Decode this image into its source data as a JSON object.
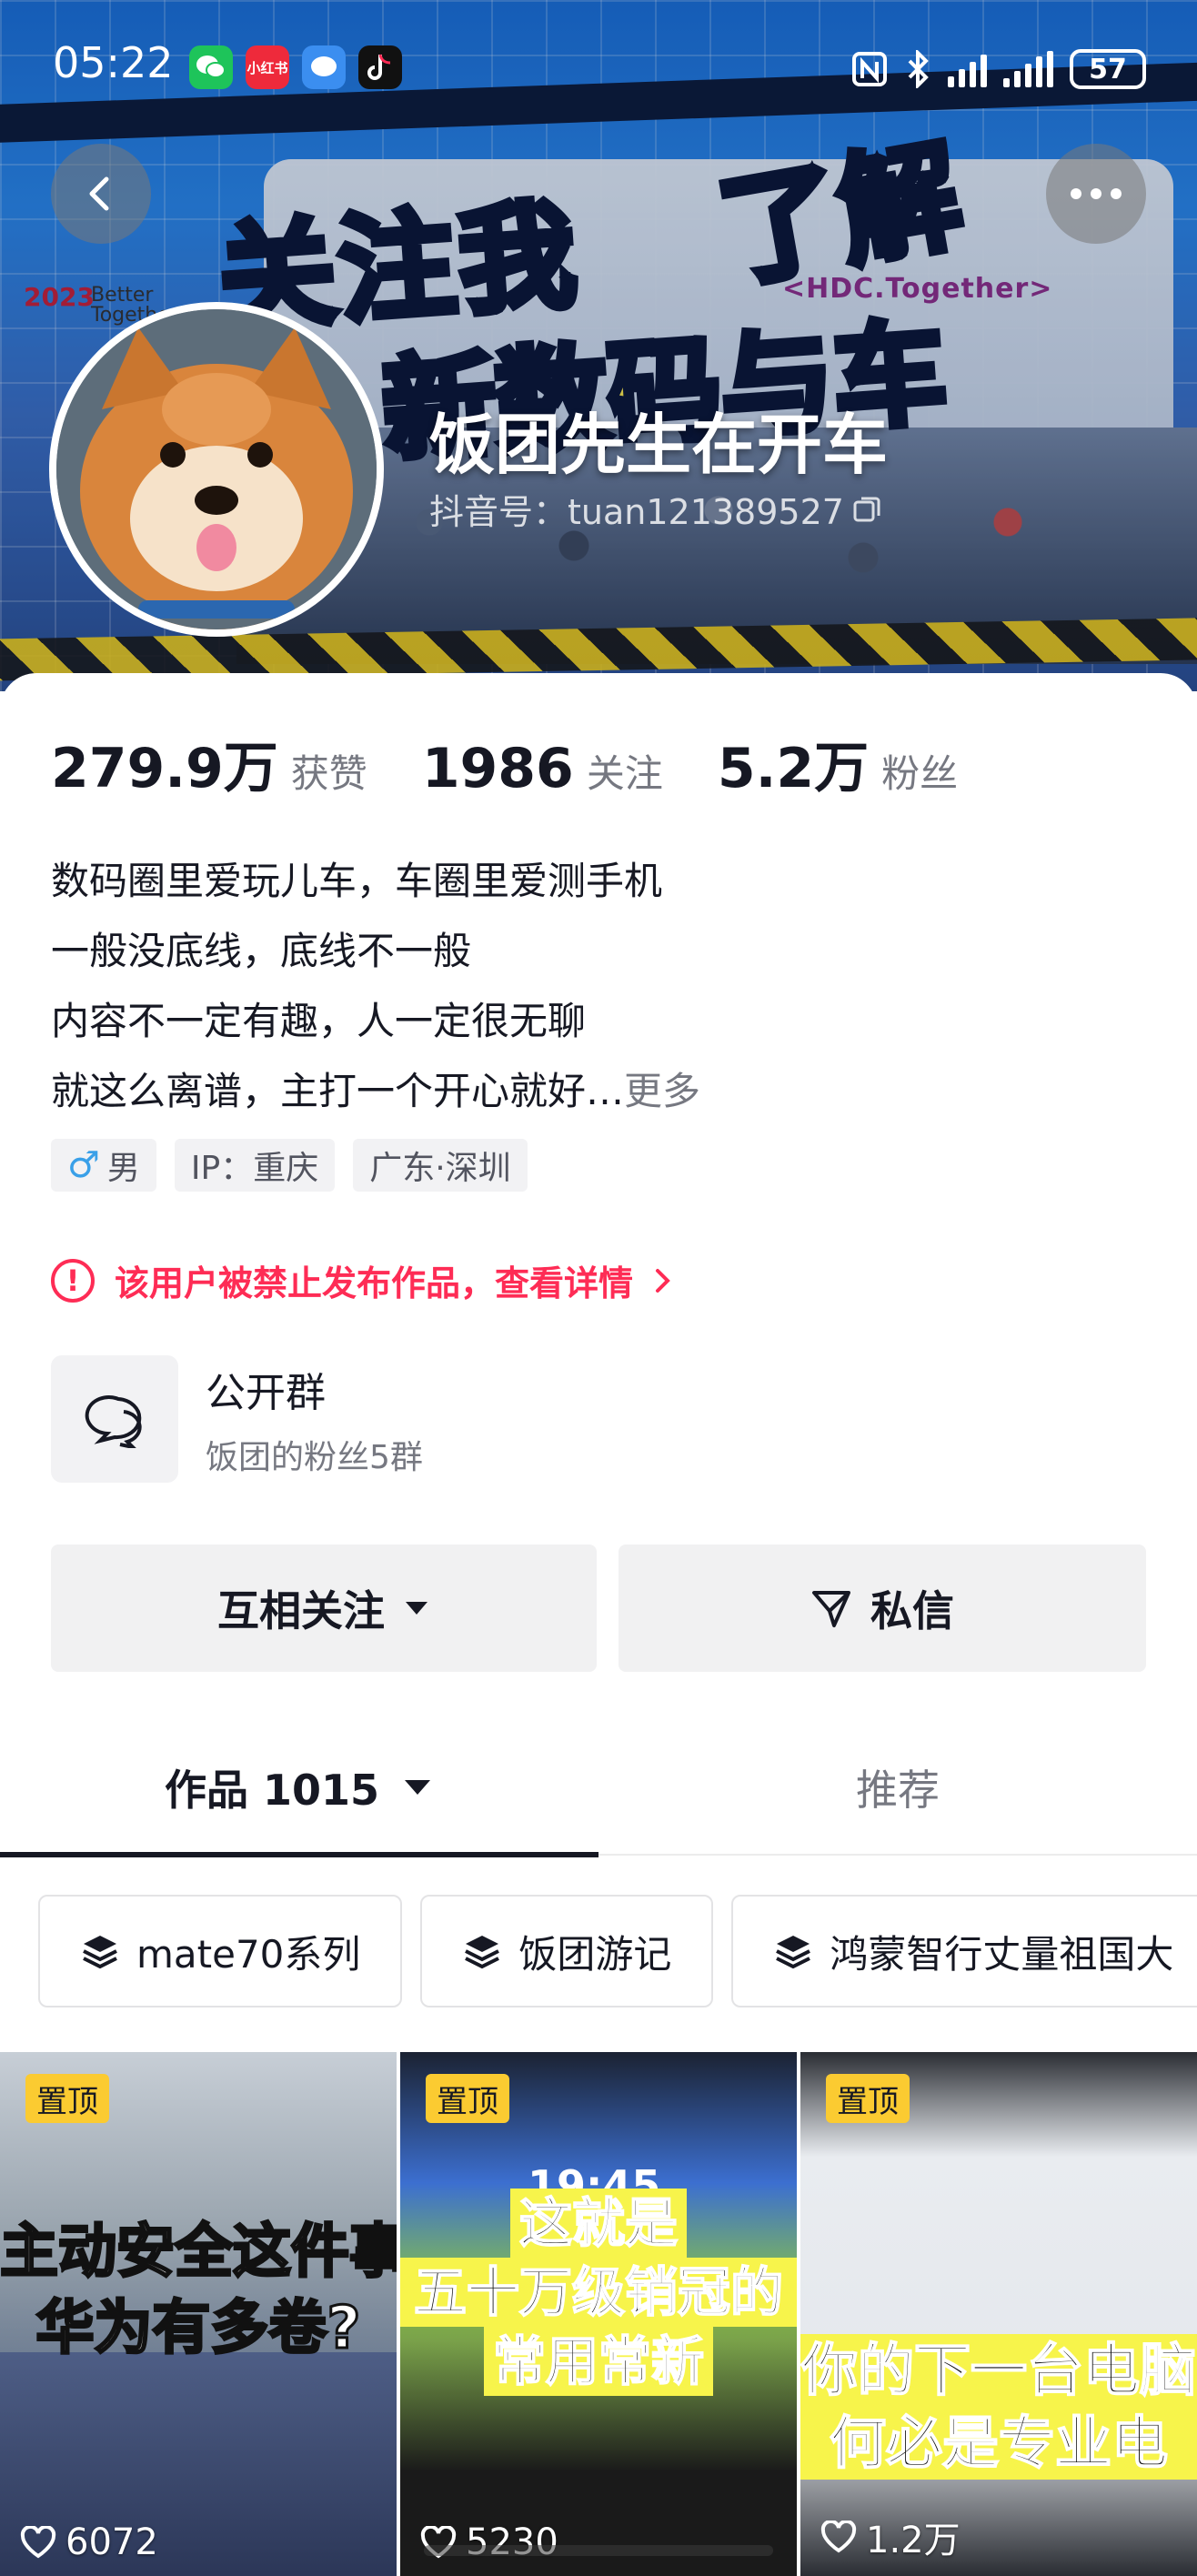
{
  "status_bar": {
    "time": "05:22",
    "battery": "57",
    "apps": [
      {
        "name": "wechat-icon",
        "label": "",
        "color": "#1ec45a"
      },
      {
        "name": "xiaohongshu-icon",
        "label": "小红书",
        "color": "#ee2a3b"
      },
      {
        "name": "message-icon",
        "label": "",
        "color": "#3b8ef0"
      },
      {
        "name": "douyin-icon",
        "label": "",
        "color": "#111111"
      }
    ]
  },
  "banner": {
    "headline_1": "关注我",
    "headline_2": "了解",
    "headline_3": "新数码与车",
    "event_logo": "2023",
    "event_logo_sub": "Better Together",
    "hdc_text": "<HDC.Together>"
  },
  "profile": {
    "nickname": "饭团先生在开车",
    "account": "抖音号：tuan121389527",
    "stats": [
      {
        "value": "279.9万",
        "label": "获赞"
      },
      {
        "value": "1986",
        "label": "关注"
      },
      {
        "value": "5.2万",
        "label": "粉丝"
      }
    ],
    "bio": [
      "数码圈里爱玩儿车，车圈里爱测手机",
      "一般没底线，底线不一般",
      "内容不一定有趣，人一定很无聊",
      "就这么离谱，主打一个开心就好…"
    ],
    "bio_more": "更多",
    "tags": {
      "gender": "男",
      "ip": "IP：重庆",
      "location": "广东·深圳"
    },
    "warning": "该用户被禁止发布作品，查看详情"
  },
  "group": {
    "title": "公开群",
    "subtitle": "饭团的粉丝5群"
  },
  "buttons": {
    "follow": "互相关注",
    "message": "私信"
  },
  "tabs": {
    "works": "作品 1015",
    "recommend": "推荐"
  },
  "collections": [
    "mate70系列",
    "饭团游记",
    "鸿蒙智行丈量祖国大"
  ],
  "videos": [
    {
      "pin": "置顶",
      "caption_1": "主动安全这件事",
      "caption_2": "华为有多卷?",
      "likes": "6072"
    },
    {
      "pin": "置顶",
      "caption_1": "这就是",
      "caption_2": "五十万级销冠的",
      "caption_3": "常用常新",
      "clock": "19:45",
      "likes": "5230"
    },
    {
      "pin": "置顶",
      "caption_1": "你的下一台电脑",
      "caption_2": "何必是专业电",
      "likes": "1.2万"
    }
  ],
  "colors": {
    "accent_red": "#fe2c55",
    "pin_yellow": "#fbcb31",
    "text_primary": "#161823",
    "text_secondary": "#767881"
  }
}
